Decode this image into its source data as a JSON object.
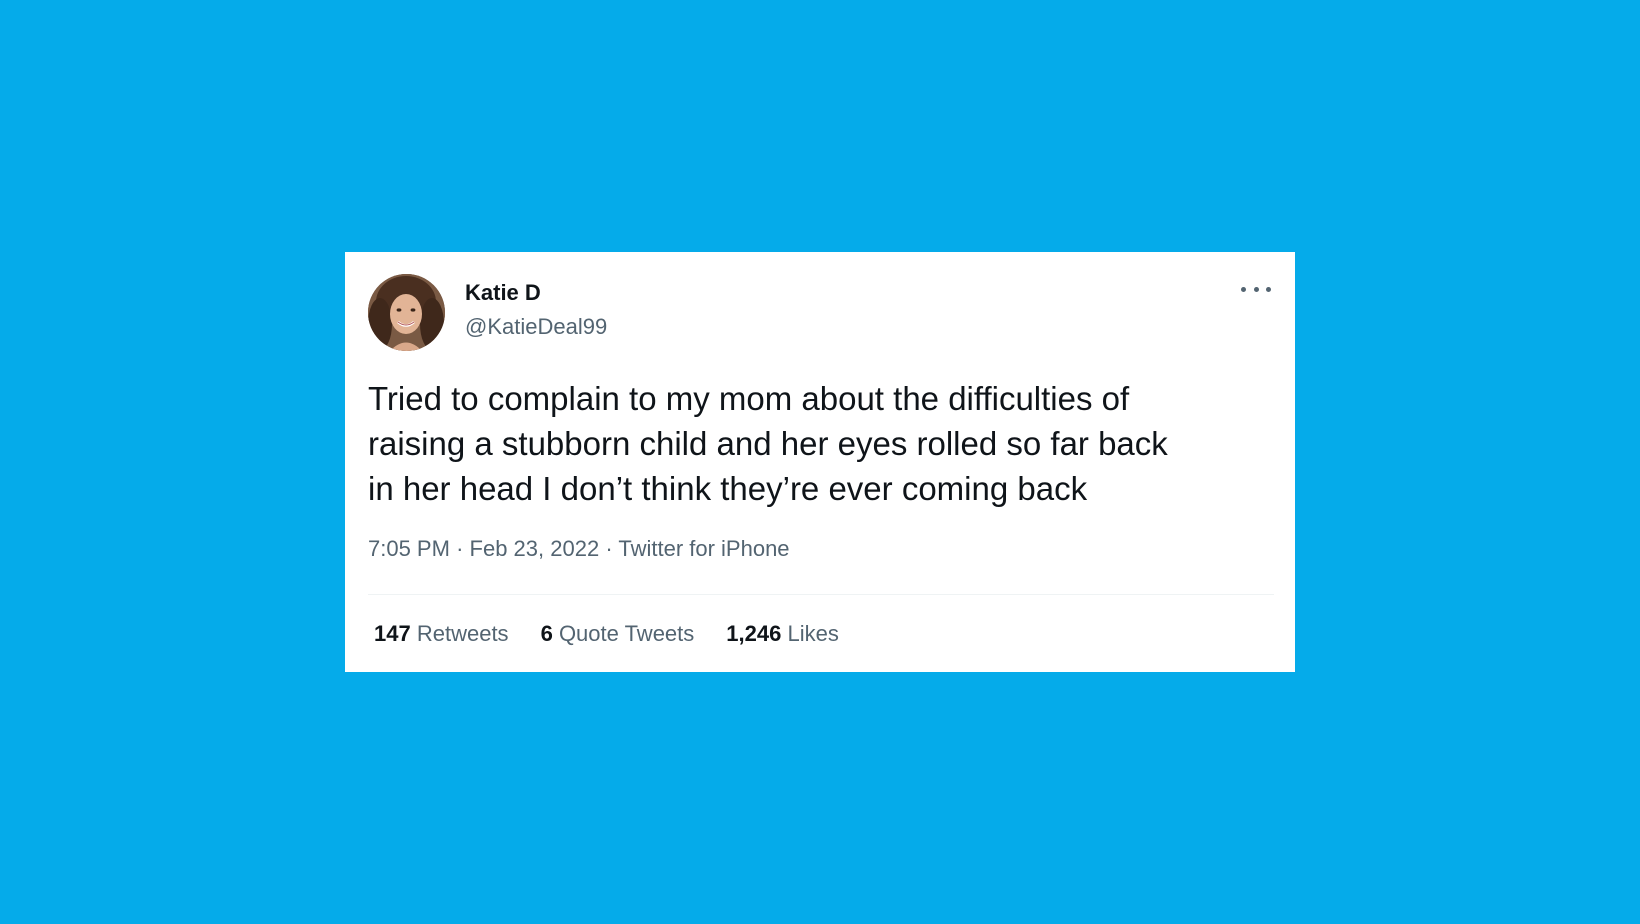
{
  "colors": {
    "background": "#05abea",
    "card": "#ffffff",
    "primary_text": "#0f1419",
    "secondary_text": "#536471"
  },
  "tweet": {
    "author": {
      "display_name": "Katie D",
      "handle": "@KatieDeal99",
      "avatar_icon": "profile-photo"
    },
    "more_icon": "ellipsis-icon",
    "text_lines": [
      "Tried to complain to my mom about the difficulties of",
      "raising a stubborn child and her eyes rolled so far back",
      "in her head I don’t think they’re ever coming back"
    ],
    "time": "7:05 PM",
    "date": "Feb 23, 2022",
    "source": "Twitter for iPhone",
    "separator": "·",
    "stats": {
      "retweets": {
        "count": "147",
        "label": "Retweets"
      },
      "quotes": {
        "count": "6",
        "label": "Quote Tweets"
      },
      "likes": {
        "count": "1,246",
        "label": "Likes"
      }
    }
  }
}
